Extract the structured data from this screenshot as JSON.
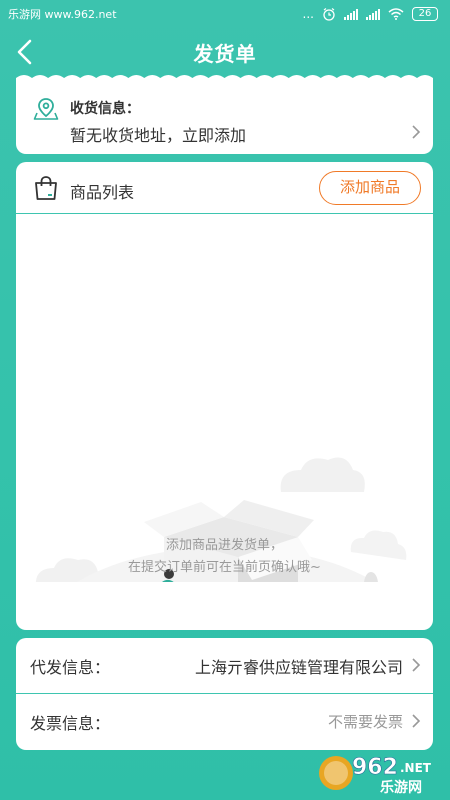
{
  "status_bar": {
    "watermark": "乐游网 www.962.net",
    "dots": "...",
    "battery": "26"
  },
  "nav": {
    "title": "发货单"
  },
  "address": {
    "label": "收货信息：",
    "value": "暂无收货地址，立即添加"
  },
  "goods": {
    "title": "商品列表",
    "add_button": "添加商品",
    "empty_line1": "添加商品进发货单，",
    "empty_line2": "在提交订单前可在当前页确认哦~"
  },
  "info": {
    "agent_label": "代发信息：",
    "agent_value": "上海亓睿供应链管理有限公司",
    "invoice_label": "发票信息：",
    "invoice_value": "不需要发票"
  },
  "watermark_logo": {
    "number": "962",
    "suffix": ".NET",
    "text": "乐游网"
  },
  "colors": {
    "background": "#36c2ab",
    "accent_orange": "#f07a28",
    "divider_teal": "#3ec5b0"
  }
}
